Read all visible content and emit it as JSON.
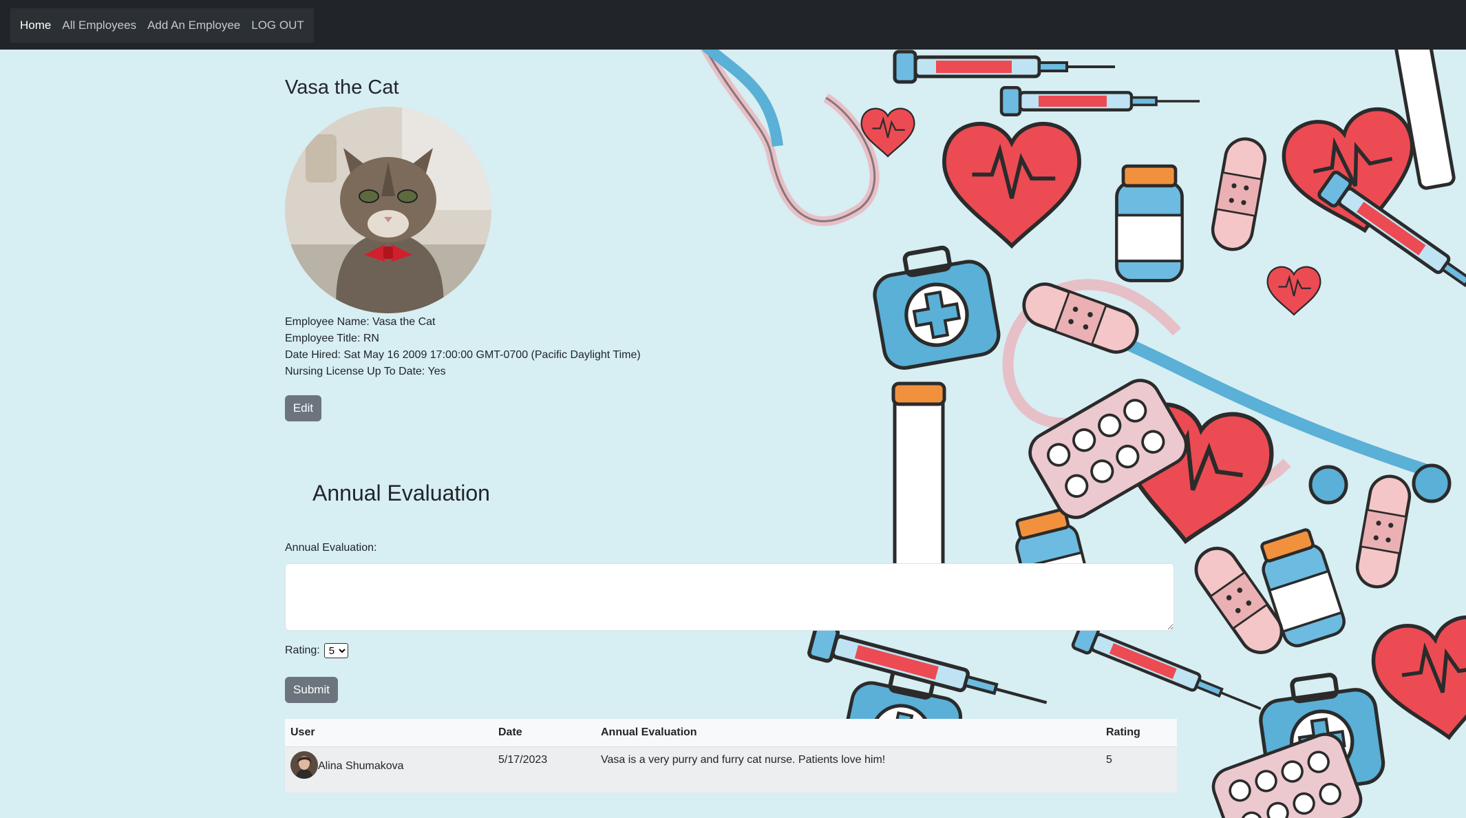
{
  "nav": {
    "home": "Home",
    "all_employees": "All Employees",
    "add_employee": "Add An Employee",
    "logout": "LOG OUT"
  },
  "employee": {
    "heading": "Vasa the Cat",
    "name_line": "Employee Name: Vasa the Cat",
    "title_line": "Employee Title: RN",
    "hired_line": "Date Hired: Sat May 16 2009 17:00:00 GMT-0700 (Pacific Daylight Time)",
    "license_line": "Nursing License Up To Date: Yes",
    "edit_label": "Edit"
  },
  "evaluation": {
    "section_title": "Annual Evaluation",
    "field_label": "Annual Evaluation:",
    "text_value": "",
    "rating_label": "Rating:",
    "rating_value": "5",
    "submit_label": "Submit"
  },
  "table": {
    "headers": [
      "User",
      "Date",
      "Annual Evaluation",
      "Rating"
    ],
    "rows": [
      {
        "user": "Alina Shumakova",
        "date": "5/17/2023",
        "evaluation": "Vasa is a very purry and furry cat nurse. Patients love him!",
        "rating": "5"
      }
    ]
  },
  "colors": {
    "navbar": "#212529",
    "page_bg": "#d7eef3",
    "button": "#6c757d",
    "heart_red": "#e8484e",
    "medical_blue": "#5ab0d6",
    "bandage_pink": "#f4c6c8"
  },
  "icons": {
    "background": "medical-pattern-illustration",
    "avatar": "cat-photo",
    "user_avatar": "user-photo"
  }
}
